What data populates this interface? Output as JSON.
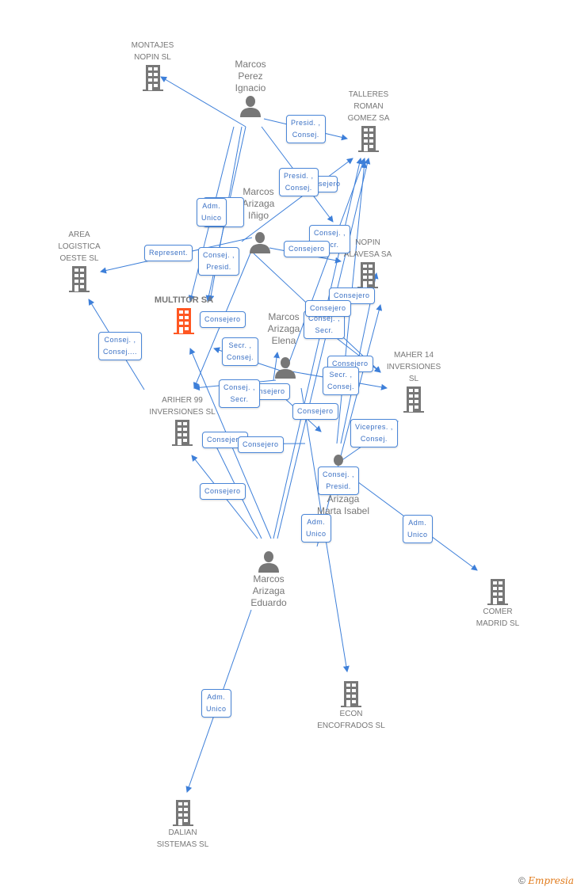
{
  "colors": {
    "edge": "#3d7fd9",
    "node_icon": "#777777",
    "main_icon": "#ff5722",
    "text": "#777777",
    "role_text": "#3a70c4"
  },
  "companies": [
    {
      "id": "montajes",
      "label": "MONTAJES\nNOPIN SL"
    },
    {
      "id": "talleres",
      "label": "TALLERES\nROMAN\nGOMEZ SA"
    },
    {
      "id": "area",
      "label": "AREA\nLOGISTICA\nOESTE SL"
    },
    {
      "id": "nopin",
      "label": "NOPIN\nALAVESA SA"
    },
    {
      "id": "multitor",
      "label": "MULTITOR SA",
      "main": true
    },
    {
      "id": "maher",
      "label": "MAHER 14\nINVERSIONES\nSL"
    },
    {
      "id": "ariher",
      "label": "ARIHER 99\nINVERSIONES SL"
    },
    {
      "id": "comer",
      "label": "COMER\nMADRID SL"
    },
    {
      "id": "econ",
      "label": "ECON\nENCOFRADOS SL"
    },
    {
      "id": "dalian",
      "label": "DALIAN\nSISTEMAS SL"
    }
  ],
  "persons": [
    {
      "id": "perez",
      "label": "Marcos\nPerez\nIgnacio"
    },
    {
      "id": "inigo",
      "label": "Marcos\nArizaga\nIñigo"
    },
    {
      "id": "elena",
      "label": "Marcos\nArizaga\nElena"
    },
    {
      "id": "marta",
      "label": "Arizaga\nMarta Isabel"
    },
    {
      "id": "eduardo",
      "label": "Marcos\nArizaga\nEduardo"
    }
  ],
  "roles": [
    "Presid. ,\nConsej.",
    "Presid. ,\nConsej.",
    "Consejero",
    "Adm.\nUnico",
    "Represent.",
    "Consej. ,\nPresid.",
    "Consej. ,\nSecr.",
    "Consejero",
    "Consejero",
    "Consejero",
    "Consejero",
    "Consej. ,\nSecr.",
    "Consej. ,\nConsej....",
    "Secr. ,\nConsej.",
    "Consejero",
    "Secr. ,\nConsej.",
    "Consej. ,\nSecr.",
    "Consejero",
    "Consejero",
    "Consejero",
    "Consejero",
    "Consejero",
    "Vicepres. ,\nConsej.",
    "Consej. ,\nPresid.",
    "Adm.\nUnico",
    "Adm.\nUnico",
    "Consejero",
    "Adm.\nUnico"
  ],
  "footer": {
    "copyright": "©",
    "brand": "Empresia"
  }
}
